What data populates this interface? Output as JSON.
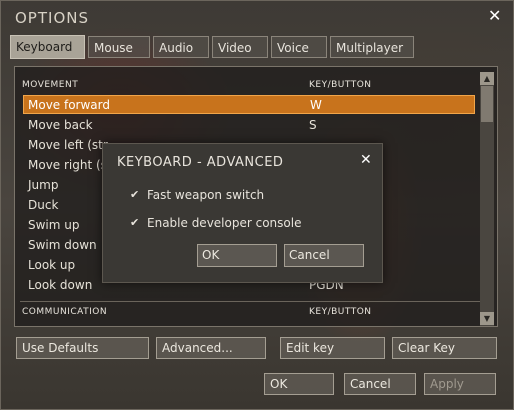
{
  "window": {
    "title": "OPTIONS"
  },
  "tabs": [
    {
      "label": "Keyboard",
      "active": true
    },
    {
      "label": "Mouse"
    },
    {
      "label": "Audio"
    },
    {
      "label": "Video"
    },
    {
      "label": "Voice"
    },
    {
      "label": "Multiplayer"
    }
  ],
  "table": {
    "section1": {
      "action_header": "MOVEMENT",
      "key_header": "KEY/BUTTON"
    },
    "rows": [
      {
        "action": "Move forward",
        "key": "W",
        "selected": true
      },
      {
        "action": "Move back",
        "key": "S"
      },
      {
        "action": "Move left (str",
        "key": ""
      },
      {
        "action": "Move right (s",
        "key": ""
      },
      {
        "action": "Jump",
        "key": ""
      },
      {
        "action": "Duck",
        "key": ""
      },
      {
        "action": "Swim up",
        "key": ""
      },
      {
        "action": "Swim down",
        "key": ""
      },
      {
        "action": "Look up",
        "key": ""
      },
      {
        "action": "Look down",
        "key": "PGDN"
      }
    ],
    "section2": {
      "action_header": "COMMUNICATION",
      "key_header": "KEY/BUTTON"
    }
  },
  "buttons": {
    "use_defaults": "Use Defaults",
    "advanced": "Advanced...",
    "edit_key": "Edit key",
    "clear_key": "Clear Key",
    "ok": "OK",
    "cancel": "Cancel",
    "apply": "Apply"
  },
  "dialog": {
    "title": "KEYBOARD - ADVANCED",
    "options": [
      {
        "label": "Fast weapon switch",
        "checked": true
      },
      {
        "label": "Enable developer console",
        "checked": true
      }
    ],
    "ok": "OK",
    "cancel": "Cancel"
  },
  "icons": {
    "close": "close-icon",
    "check": "checkmark-icon",
    "scroll_up": "arrow-up-icon",
    "scroll_down": "arrow-down-icon"
  },
  "colors": {
    "selection": "#c8731c",
    "selection_border": "#f1a54a"
  }
}
